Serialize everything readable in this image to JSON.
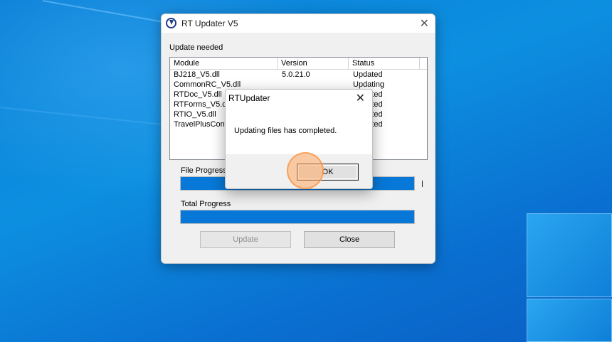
{
  "main_window": {
    "title": "RT Updater V5",
    "status_label": "Update needed",
    "columns": [
      "Module",
      "Version",
      "Status"
    ],
    "rows": [
      {
        "module": "BJ218_V5.dll",
        "version": "5.0.21.0",
        "status": "Updated"
      },
      {
        "module": "CommonRC_V5.dll",
        "version": "",
        "status": "Updating"
      },
      {
        "module": "RTDoc_V5.dll",
        "version": "",
        "status": "Updated"
      },
      {
        "module": "RTForms_V5.dll",
        "version": "",
        "status": "Updated"
      },
      {
        "module": "RTIO_V5.dll",
        "version": "",
        "status": "Updated"
      },
      {
        "module": "TravelPlusConv",
        "version": "",
        "status": "Updated"
      }
    ],
    "file_progress_label": "File Progress",
    "file_progress_value": 1.0,
    "total_progress_label": "Total Progress",
    "total_progress_value": 1.0,
    "update_button": "Update",
    "close_button": "Close"
  },
  "dialog": {
    "title": "RTUpdater",
    "message": "Updating files has completed.",
    "ok_button": "OK"
  },
  "colors": {
    "progress_fill": "#0778d7",
    "desktop": "#0a7fd6"
  }
}
